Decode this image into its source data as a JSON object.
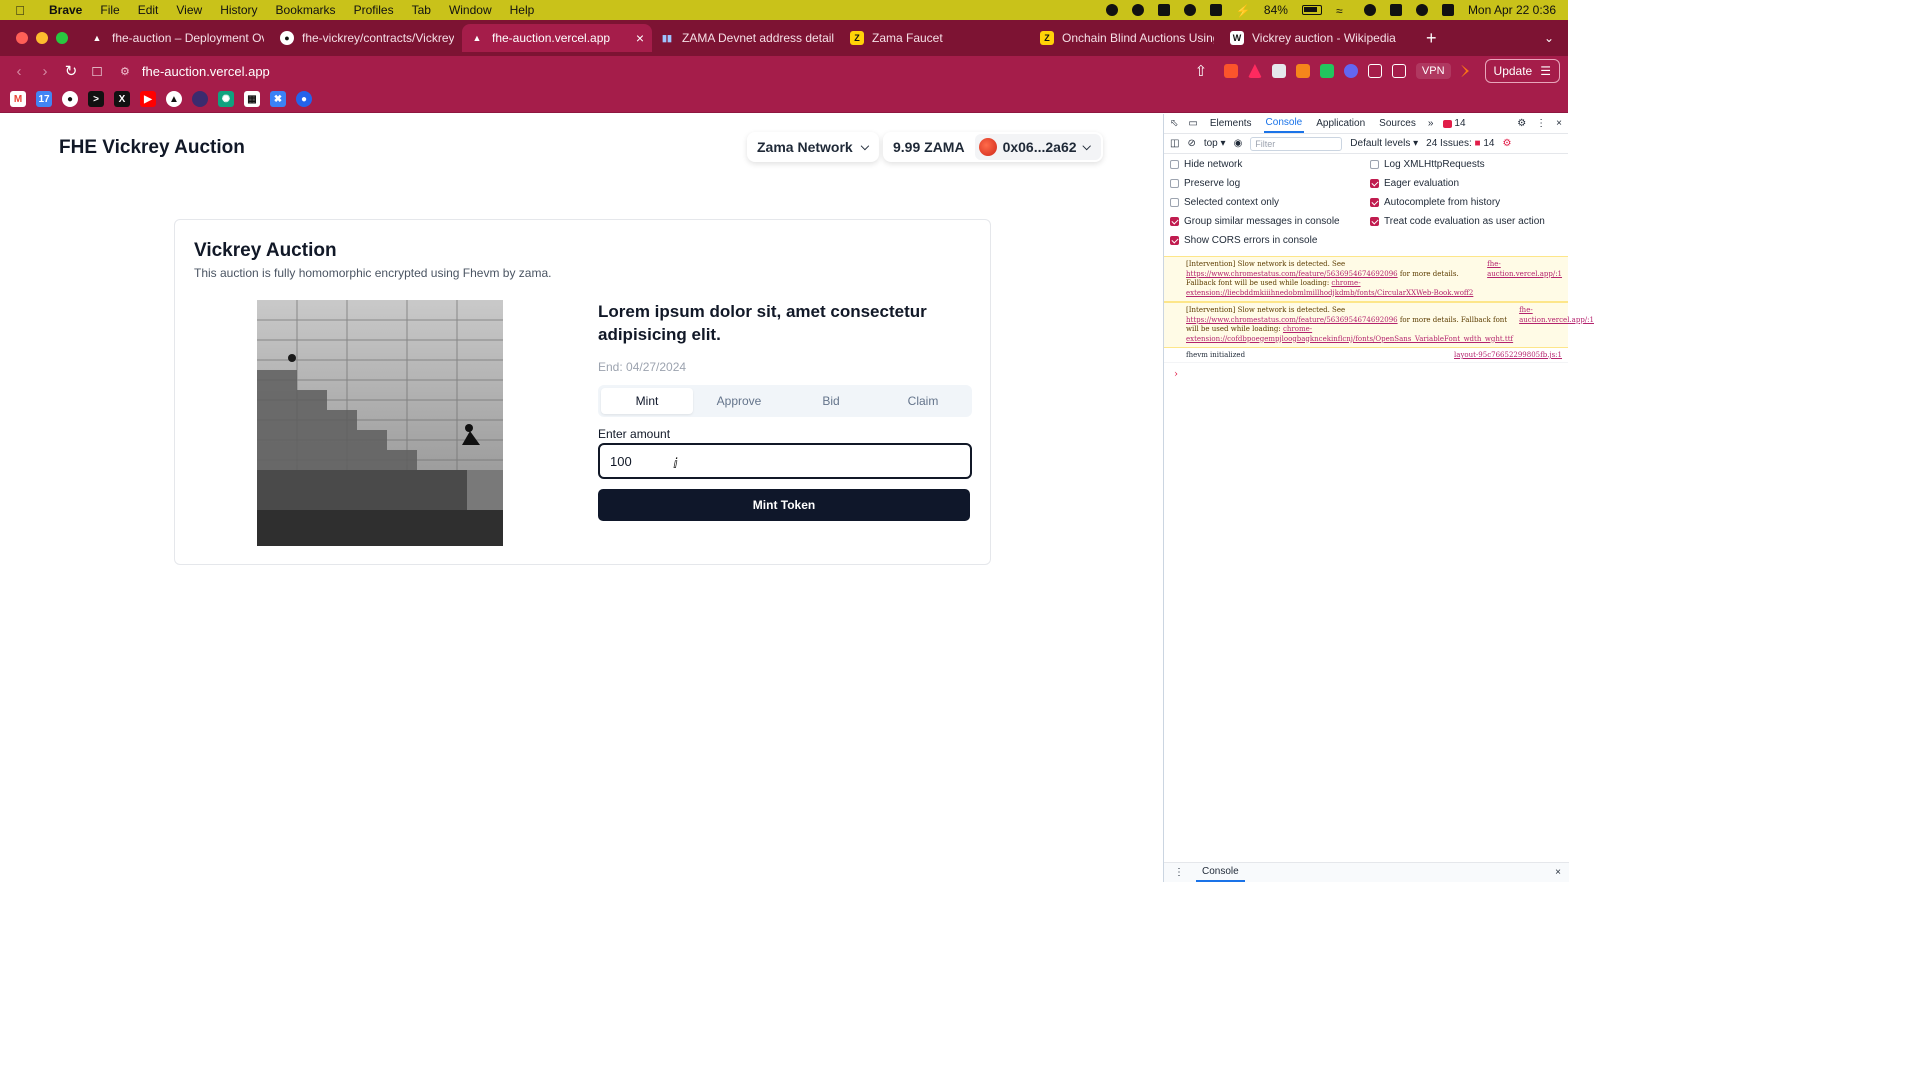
{
  "menubar": {
    "app": "Brave",
    "items": [
      "File",
      "Edit",
      "View",
      "History",
      "Bookmarks",
      "Profiles",
      "Tab",
      "Window",
      "Help"
    ],
    "battery": "84%",
    "datetime": "Mon Apr 22  0:36"
  },
  "tabs": [
    {
      "label": "fhe-auction – Deployment Overvie",
      "icon": "vercel-icon"
    },
    {
      "label": "fhe-vickrey/contracts/VickreyAuct",
      "icon": "github-icon"
    },
    {
      "label": "fhe-auction.vercel.app",
      "icon": "vercel-icon",
      "active": true
    },
    {
      "label": "ZAMA Devnet address details for",
      "icon": "explorer-icon"
    },
    {
      "label": "Zama Faucet",
      "icon": "zama-icon"
    },
    {
      "label": "Onchain Blind Auctions Using Hon",
      "icon": "zama-icon"
    },
    {
      "label": "Vickrey auction - Wikipedia",
      "icon": "wikipedia-icon"
    }
  ],
  "address": {
    "url": "fhe-auction.vercel.app",
    "vpn": "VPN",
    "update": "Update"
  },
  "app": {
    "title": "FHE Vickrey Auction",
    "network": "Zama Network",
    "balance": "9.99 ZAMA",
    "account": "0x06...2a62"
  },
  "auction": {
    "title": "Vickrey Auction",
    "subtitle": "This auction is fully homomorphic encrypted using Fhevm by zama.",
    "item_title": "Lorem ipsum dolor sit, amet consectetur adipisicing elit.",
    "end": "End: 04/27/2024",
    "tabs": [
      "Mint",
      "Approve",
      "Bid",
      "Claim"
    ],
    "active_tab": "Mint",
    "amount_label": "Enter amount",
    "amount_value": "100",
    "action_button": "Mint Token"
  },
  "devtools": {
    "tabs": [
      "Elements",
      "Console",
      "Application",
      "Sources"
    ],
    "active_tab": "Console",
    "message_count": "14",
    "context": "top",
    "filter_placeholder": "Filter",
    "levels": "Default levels",
    "issues": "24 Issues:",
    "issues_count": "14",
    "settings": [
      {
        "label": "Hide network",
        "checked": false
      },
      {
        "label": "Log XMLHttpRequests",
        "checked": false
      },
      {
        "label": "Preserve log",
        "checked": false
      },
      {
        "label": "Eager evaluation",
        "checked": true
      },
      {
        "label": "Selected context only",
        "checked": false
      },
      {
        "label": "Autocomplete from history",
        "checked": true
      },
      {
        "label": "Group similar messages in console",
        "checked": true
      },
      {
        "label": "Treat code evaluation as user action",
        "checked": true
      },
      {
        "label": "Show CORS errors in console",
        "checked": true
      }
    ],
    "messages": [
      {
        "text_a": "[Intervention] Slow network is detected. See ",
        "link_a": "https://www.chromestatus.com/feature/5636954674692096",
        "text_b": " for more details. Fallback font will be used while loading: ",
        "link_b": "chrome-extension://liecbddmkiiihnedobmlmillhodjkdmb/fonts/CircularXXWeb-Book.woff2",
        "source": "fhe-auction.vercel.app/:1"
      },
      {
        "text_a": "[Intervention] Slow network is detected. See ",
        "link_a": "https://www.chromestatus.com/feature/5636954674692096",
        "text_b": " for more details. Fallback font will be used while loading: ",
        "link_b": "chrome-extension://cofdbpoegempjloogbagkncekinflcnj/fonts/OpenSans_VariableFont_wdth_wght.ttf",
        "source": "fhe-auction.vercel.app/:1"
      }
    ],
    "info": {
      "text": "fhevm initialized",
      "source": "layout-95c76652299805fb.js:1"
    },
    "drawer_tab": "Console"
  },
  "colors": {
    "tab_bar": "#7d1333",
    "toolbar": "#a51d4a",
    "menubar": "#c9c21a",
    "primary_button": "#0f172a"
  }
}
